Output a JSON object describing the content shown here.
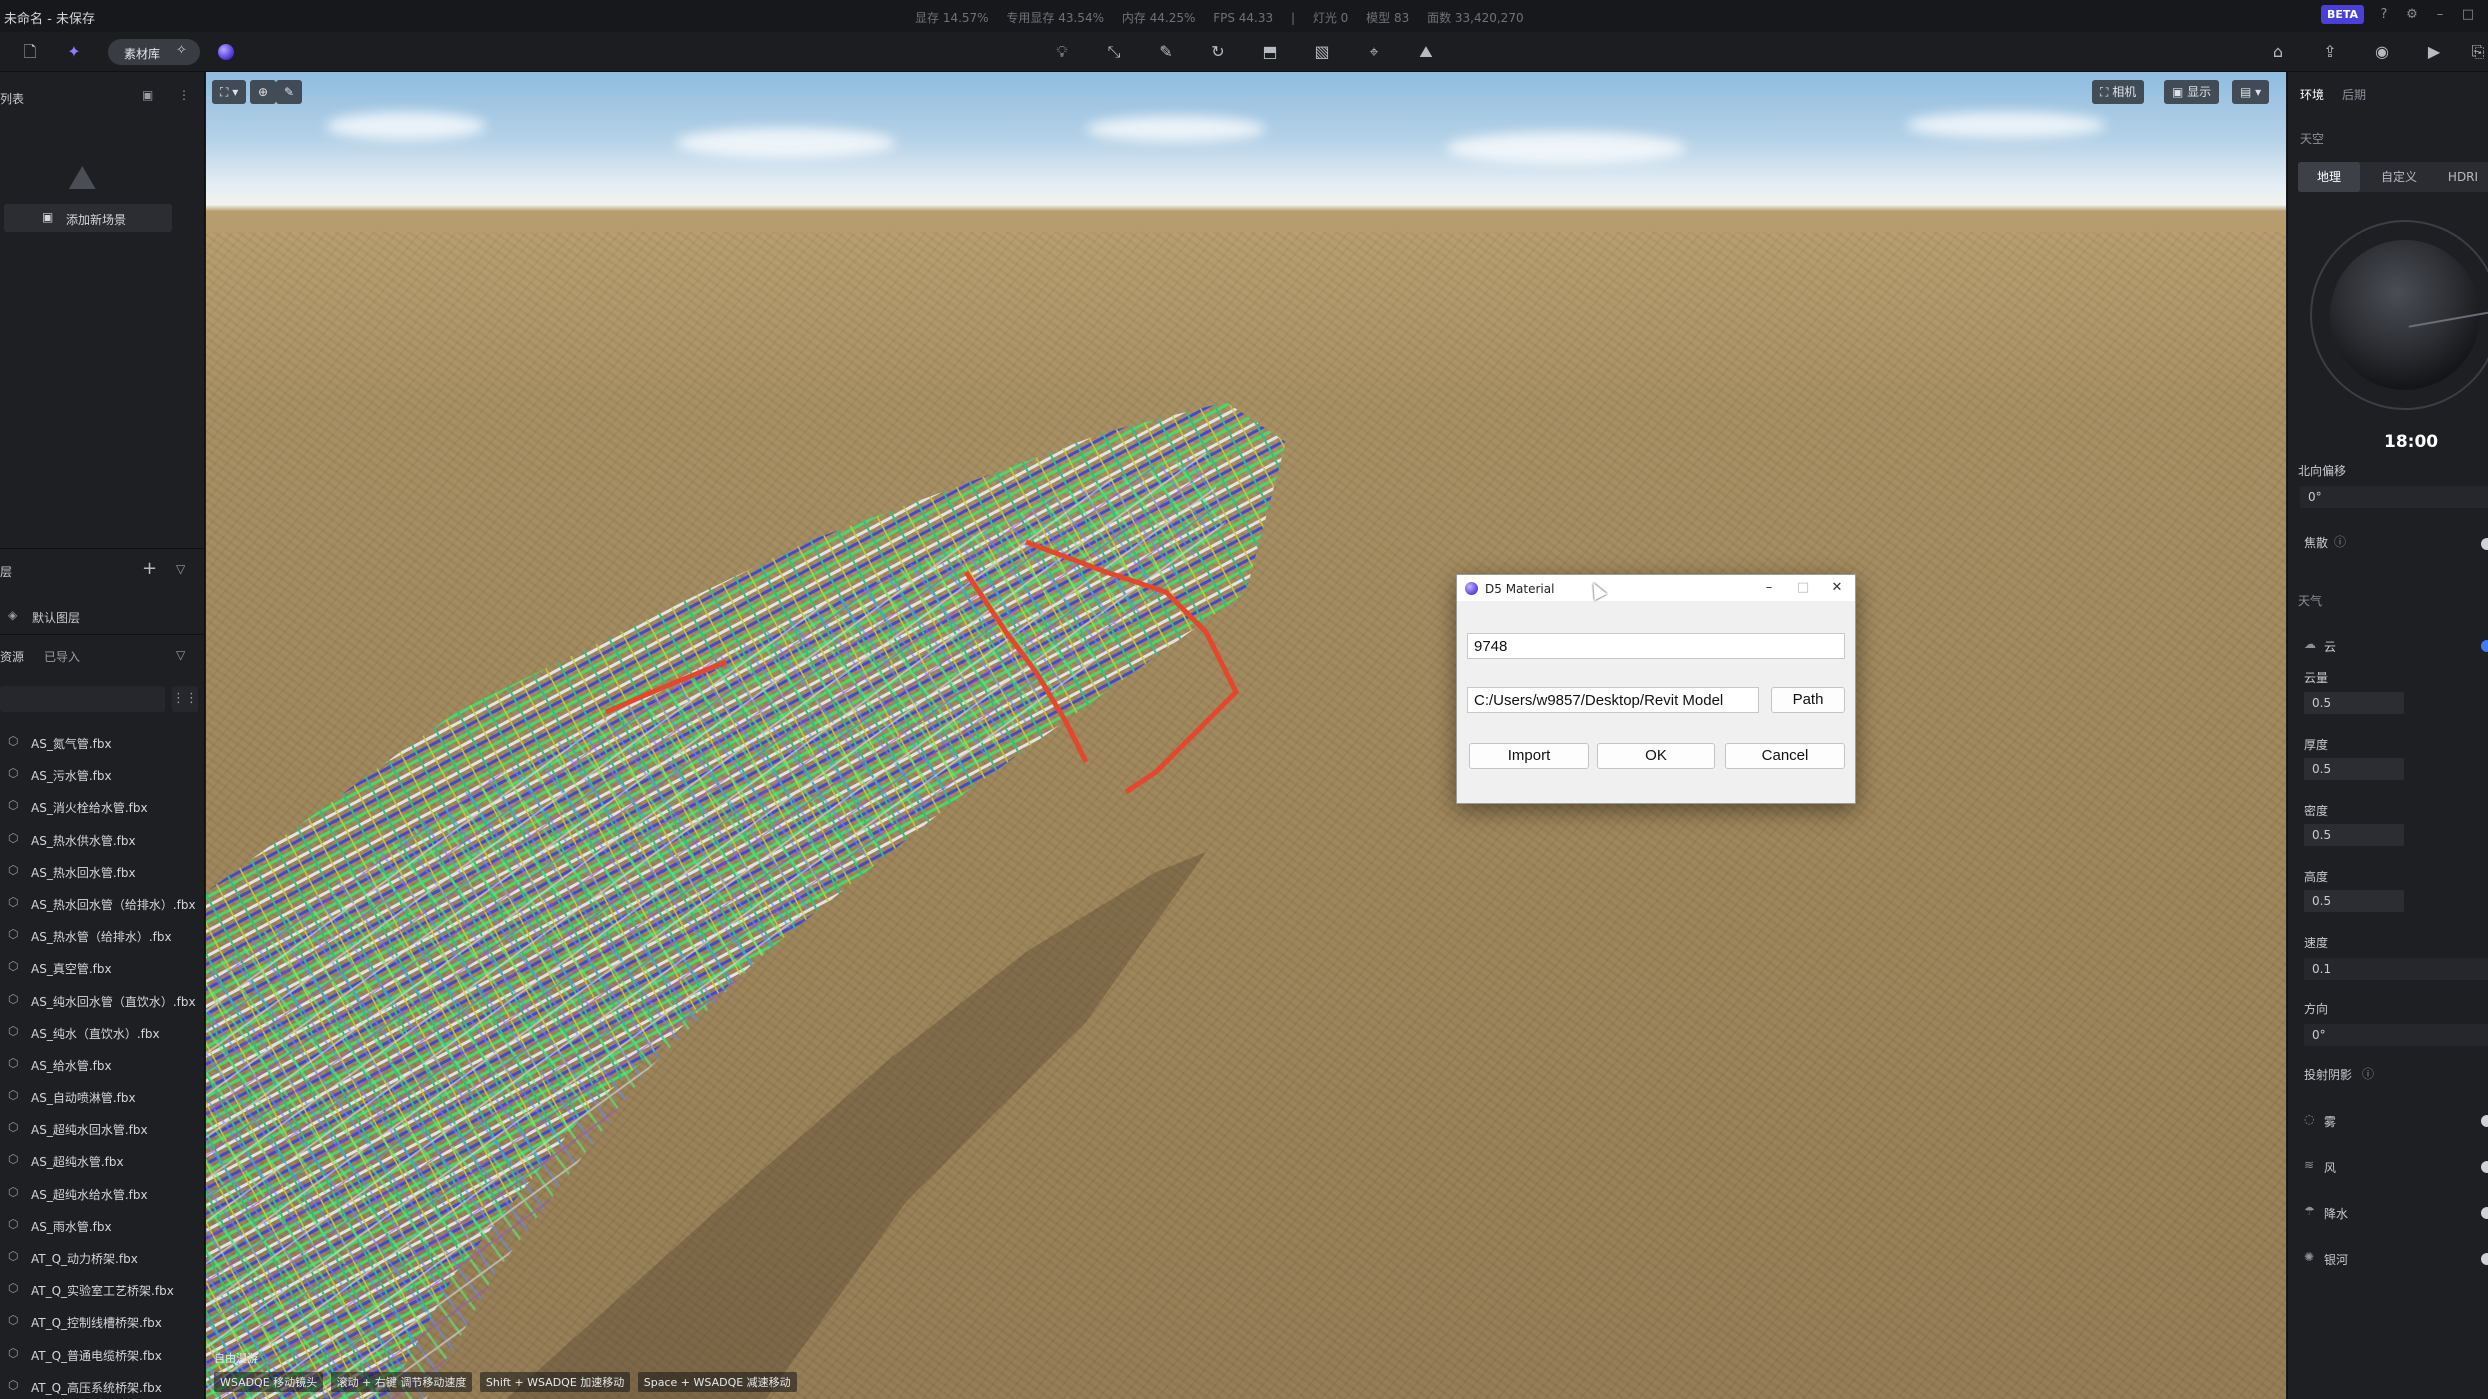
{
  "window": {
    "title": "未命名 - 未保存",
    "stats": [
      "显存 14.57%",
      "专用显存 43.54%",
      "内存 44.25%",
      "FPS 44.33",
      "|",
      "灯光 0",
      "模型 83",
      "面数 33,420,270"
    ],
    "beta": "BETA"
  },
  "toolbar": {
    "asset_library_label": "素材库"
  },
  "left_panel": {
    "scene_list_title": "列表",
    "add_scene_label": "添加新场景",
    "layers_title": "层",
    "default_layer": "默认图层",
    "assets_title": "资源",
    "imported_tab": "已导入",
    "files": [
      "AS_氮气管.fbx",
      "AS_污水管.fbx",
      "AS_消火栓给水管.fbx",
      "AS_热水供水管.fbx",
      "AS_热水回水管.fbx",
      "AS_热水回水管（给排水）.fbx",
      "AS_热水管（给排水）.fbx",
      "AS_真空管.fbx",
      "AS_纯水回水管（直饮水）.fbx",
      "AS_纯水（直饮水）.fbx",
      "AS_给水管.fbx",
      "AS_自动喷淋管.fbx",
      "AS_超纯水回水管.fbx",
      "AS_超纯水管.fbx",
      "AS_超纯水给水管.fbx",
      "AS_雨水管.fbx",
      "AT_Q_动力桥架.fbx",
      "AT_Q_实验室工艺桥架.fbx",
      "AT_Q_控制线槽桥架.fbx",
      "AT_Q_普通电缆桥架.fbx",
      "AT_Q_高压系统桥架.fbx"
    ]
  },
  "viewport": {
    "camera_label": "相机",
    "display_label": "显示",
    "overlay_label": "自由漫游",
    "hints": [
      "WSADQE 移动镜头",
      "滚动 + 右键 调节移动速度",
      "Shift + WSADQE 加速移动",
      "Space + WSADQE 减速移动"
    ]
  },
  "dialog": {
    "title": "D5 Material",
    "id_value": "9748",
    "path_value": "C:/Users/w9857/Desktop/Revit Model",
    "path_button": "Path",
    "import_button": "Import",
    "ok_button": "OK",
    "cancel_button": "Cancel"
  },
  "right_panel": {
    "tab_environment": "环境",
    "tab_post": "后期",
    "sky_title": "天空",
    "sky_modes": [
      "地理",
      "自定义",
      "HDRI"
    ],
    "time": "18:00",
    "north_offset_label": "北向偏移",
    "north_offset_value": "0°",
    "focus_label": "焦散",
    "weather_title": "天气",
    "cloud_label": "云",
    "cloud_amount_label": "云量",
    "cloud_amount": "0.5",
    "thickness_label": "厚度",
    "thickness": "0.5",
    "density_label": "密度",
    "density": "0.5",
    "height_label": "高度",
    "height": "0.5",
    "speed_label": "速度",
    "speed": "0.1",
    "direction_label": "方向",
    "direction": "0°",
    "cast_shadow_label": "投射阴影",
    "fog_label": "雾",
    "wind_label": "风",
    "rain_label": "降水",
    "galaxy_label": "银河",
    "accent_color": "#3f7bff"
  }
}
